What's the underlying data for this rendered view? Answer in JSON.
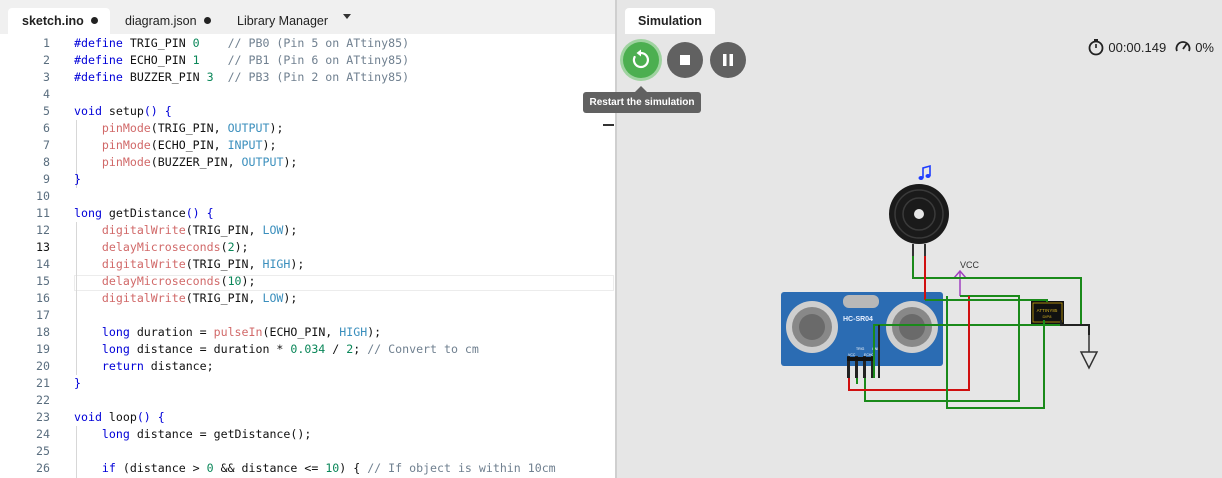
{
  "editor": {
    "tabs": [
      {
        "label": "sketch.ino",
        "modified": true
      },
      {
        "label": "diagram.json",
        "modified": true
      },
      {
        "label": "Library Manager"
      }
    ],
    "current_line": 13,
    "lines": [
      {
        "n": "1",
        "tokens": [
          {
            "t": "#define ",
            "c": "k"
          },
          {
            "t": "TRIG_PIN ",
            "c": "p"
          },
          {
            "t": "0",
            "c": "n"
          },
          {
            "t": "    // PB0 (Pin 5 on ATtiny85)",
            "c": "c"
          }
        ]
      },
      {
        "n": "2",
        "tokens": [
          {
            "t": "#define ",
            "c": "k"
          },
          {
            "t": "ECHO_PIN ",
            "c": "p"
          },
          {
            "t": "1",
            "c": "n"
          },
          {
            "t": "    // PB1 (Pin 6 on ATtiny85)",
            "c": "c"
          }
        ]
      },
      {
        "n": "3",
        "tokens": [
          {
            "t": "#define ",
            "c": "k"
          },
          {
            "t": "BUZZER_PIN ",
            "c": "p"
          },
          {
            "t": "3",
            "c": "n"
          },
          {
            "t": "  // PB3 (Pin 2 on ATtiny85)",
            "c": "c"
          }
        ]
      },
      {
        "n": "4",
        "tokens": []
      },
      {
        "n": "5",
        "tokens": [
          {
            "t": "void ",
            "c": "k"
          },
          {
            "t": "setup",
            "c": "p"
          },
          {
            "t": "() {",
            "c": "k"
          }
        ]
      },
      {
        "n": "6",
        "tokens": [
          {
            "t": "    ",
            "c": "p"
          },
          {
            "t": "pinMode",
            "c": "f"
          },
          {
            "t": "(TRIG_PIN, ",
            "c": "p"
          },
          {
            "t": "OUTPUT",
            "c": "t"
          },
          {
            "t": ");",
            "c": "p"
          }
        ]
      },
      {
        "n": "7",
        "tokens": [
          {
            "t": "    ",
            "c": "p"
          },
          {
            "t": "pinMode",
            "c": "f"
          },
          {
            "t": "(ECHO_PIN, ",
            "c": "p"
          },
          {
            "t": "INPUT",
            "c": "t"
          },
          {
            "t": ");",
            "c": "p"
          }
        ]
      },
      {
        "n": "8",
        "tokens": [
          {
            "t": "    ",
            "c": "p"
          },
          {
            "t": "pinMode",
            "c": "f"
          },
          {
            "t": "(BUZZER_PIN, ",
            "c": "p"
          },
          {
            "t": "OUTPUT",
            "c": "t"
          },
          {
            "t": ");",
            "c": "p"
          }
        ]
      },
      {
        "n": "9",
        "tokens": [
          {
            "t": "}",
            "c": "k"
          }
        ]
      },
      {
        "n": "10",
        "tokens": []
      },
      {
        "n": "11",
        "tokens": [
          {
            "t": "long ",
            "c": "k"
          },
          {
            "t": "getDistance",
            "c": "p"
          },
          {
            "t": "() {",
            "c": "k"
          }
        ]
      },
      {
        "n": "12",
        "tokens": [
          {
            "t": "    ",
            "c": "p"
          },
          {
            "t": "digitalWrite",
            "c": "f"
          },
          {
            "t": "(TRIG_PIN, ",
            "c": "p"
          },
          {
            "t": "LOW",
            "c": "t"
          },
          {
            "t": ");",
            "c": "p"
          }
        ]
      },
      {
        "n": "13",
        "tokens": [
          {
            "t": "    ",
            "c": "p"
          },
          {
            "t": "delayMicroseconds",
            "c": "f"
          },
          {
            "t": "(",
            "c": "p"
          },
          {
            "t": "2",
            "c": "n"
          },
          {
            "t": ");",
            "c": "p"
          }
        ]
      },
      {
        "n": "14",
        "tokens": [
          {
            "t": "    ",
            "c": "p"
          },
          {
            "t": "digitalWrite",
            "c": "f"
          },
          {
            "t": "(TRIG_PIN, ",
            "c": "p"
          },
          {
            "t": "HIGH",
            "c": "t"
          },
          {
            "t": ");",
            "c": "p"
          }
        ]
      },
      {
        "n": "15",
        "tokens": [
          {
            "t": "    ",
            "c": "p"
          },
          {
            "t": "delayMicroseconds",
            "c": "f"
          },
          {
            "t": "(",
            "c": "p"
          },
          {
            "t": "10",
            "c": "n"
          },
          {
            "t": ");",
            "c": "p"
          }
        ]
      },
      {
        "n": "16",
        "tokens": [
          {
            "t": "    ",
            "c": "p"
          },
          {
            "t": "digitalWrite",
            "c": "f"
          },
          {
            "t": "(TRIG_PIN, ",
            "c": "p"
          },
          {
            "t": "LOW",
            "c": "t"
          },
          {
            "t": ");",
            "c": "p"
          }
        ]
      },
      {
        "n": "17",
        "tokens": []
      },
      {
        "n": "18",
        "tokens": [
          {
            "t": "    ",
            "c": "p"
          },
          {
            "t": "long ",
            "c": "k"
          },
          {
            "t": "duration = ",
            "c": "p"
          },
          {
            "t": "pulseIn",
            "c": "f"
          },
          {
            "t": "(ECHO_PIN, ",
            "c": "p"
          },
          {
            "t": "HIGH",
            "c": "t"
          },
          {
            "t": ");",
            "c": "p"
          }
        ]
      },
      {
        "n": "19",
        "tokens": [
          {
            "t": "    ",
            "c": "p"
          },
          {
            "t": "long ",
            "c": "k"
          },
          {
            "t": "distance = duration * ",
            "c": "p"
          },
          {
            "t": "0.034",
            "c": "n"
          },
          {
            "t": " / ",
            "c": "p"
          },
          {
            "t": "2",
            "c": "n"
          },
          {
            "t": "; ",
            "c": "p"
          },
          {
            "t": "// Convert to cm",
            "c": "c"
          }
        ]
      },
      {
        "n": "20",
        "tokens": [
          {
            "t": "    ",
            "c": "p"
          },
          {
            "t": "return ",
            "c": "k"
          },
          {
            "t": "distance;",
            "c": "p"
          }
        ]
      },
      {
        "n": "21",
        "tokens": [
          {
            "t": "}",
            "c": "k"
          }
        ]
      },
      {
        "n": "22",
        "tokens": []
      },
      {
        "n": "23",
        "tokens": [
          {
            "t": "void ",
            "c": "k"
          },
          {
            "t": "loop",
            "c": "p"
          },
          {
            "t": "() {",
            "c": "k"
          }
        ]
      },
      {
        "n": "24",
        "tokens": [
          {
            "t": "    ",
            "c": "p"
          },
          {
            "t": "long ",
            "c": "k"
          },
          {
            "t": "distance = ",
            "c": "p"
          },
          {
            "t": "getDistance",
            "c": "p"
          },
          {
            "t": "();",
            "c": "p"
          }
        ]
      },
      {
        "n": "25",
        "tokens": []
      },
      {
        "n": "26",
        "tokens": [
          {
            "t": "    ",
            "c": "p"
          },
          {
            "t": "if ",
            "c": "k"
          },
          {
            "t": "(distance > ",
            "c": "p"
          },
          {
            "t": "0",
            "c": "n"
          },
          {
            "t": " && distance <= ",
            "c": "p"
          },
          {
            "t": "10",
            "c": "n"
          },
          {
            "t": ") { ",
            "c": "p"
          },
          {
            "t": "// If object is within 10cm",
            "c": "c"
          }
        ]
      }
    ]
  },
  "simulation": {
    "tab_label": "Simulation",
    "tooltip": "Restart the simulation",
    "timer": "00:00.149",
    "speed": "0%",
    "buttons": [
      {
        "name": "restart",
        "icon": "restart-icon",
        "color": "#4caf50"
      },
      {
        "name": "stop",
        "icon": "stop-icon",
        "color": "#616161"
      },
      {
        "name": "pause",
        "icon": "pause-icon",
        "color": "#616161"
      }
    ],
    "circuit": {
      "vcc_label": "VCC",
      "sensor_label": "HC-SR04",
      "sensor_pins": [
        "VCC",
        "TRIG",
        "ECHO",
        "GND"
      ],
      "chip_label": "ATTINY85",
      "chip_sub": "DIP8",
      "buzzer_icon": "music-note-icon"
    }
  }
}
